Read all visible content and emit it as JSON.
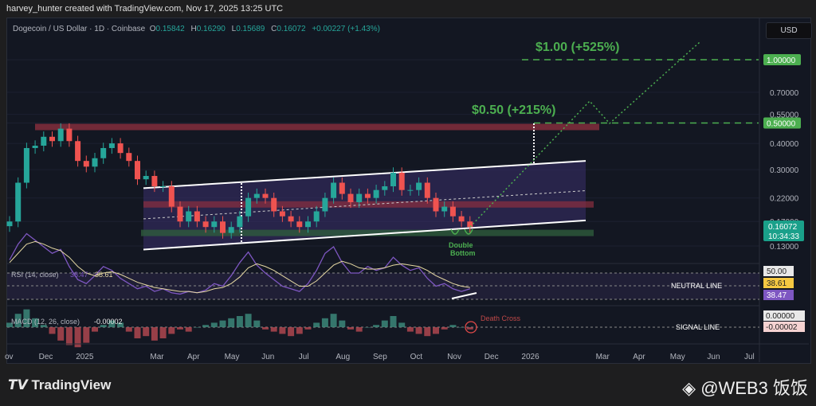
{
  "header": {
    "credit": "harvey_hunter created with TradingView.com, Nov 17, 2025 13:25 UTC"
  },
  "legend": {
    "symbol": "Dogecoin / US Dollar · 1D · Coinbase",
    "o_label": "O",
    "o": "0.15842",
    "h_label": "H",
    "h": "0.16290",
    "l_label": "L",
    "l": "0.15689",
    "c_label": "C",
    "c": "0.16072",
    "change": "+0.00227 (+1.43%)"
  },
  "currency": "USD",
  "colors": {
    "up": "#26a69a",
    "down": "#ef5350",
    "target": "#4caf50",
    "rsi": "#7e57c2",
    "rsi_ma": "#e6d9a3",
    "zone_red": "#8b2f3f",
    "channel": "#3b2f6b"
  },
  "chart_data": {
    "type": "candlestick",
    "title": "Dogecoin / US Dollar · 1D · Coinbase",
    "y_scale": "log",
    "ylim": [
      0.115,
      1.3
    ],
    "y_ticks": [
      "1.00000",
      "0.70000",
      "0.55000",
      "0.50000",
      "0.40000",
      "0.30000",
      "0.22000",
      "0.17000",
      "0.13000"
    ],
    "x_ticks": [
      "ov",
      "Dec",
      "2025",
      "Mar",
      "Apr",
      "May",
      "Jun",
      "Jul",
      "Aug",
      "Sep",
      "Oct",
      "Nov",
      "Dec",
      "2026",
      "Mar",
      "Apr",
      "May",
      "Jun",
      "Jul"
    ],
    "x_tick_months": [
      0,
      1,
      2,
      4,
      5,
      6,
      7,
      8,
      9,
      10,
      11,
      12,
      13,
      14,
      16,
      17,
      18,
      19,
      20
    ],
    "weekly_closes": [
      0.17,
      0.26,
      0.38,
      0.39,
      0.43,
      0.41,
      0.47,
      0.41,
      0.33,
      0.31,
      0.34,
      0.38,
      0.4,
      0.36,
      0.33,
      0.27,
      0.28,
      0.25,
      0.25,
      0.2,
      0.17,
      0.19,
      0.17,
      0.16,
      0.17,
      0.15,
      0.16,
      0.18,
      0.22,
      0.23,
      0.22,
      0.19,
      0.18,
      0.17,
      0.16,
      0.17,
      0.19,
      0.22,
      0.26,
      0.23,
      0.21,
      0.23,
      0.22,
      0.24,
      0.25,
      0.29,
      0.24,
      0.24,
      0.26,
      0.22,
      0.19,
      0.2,
      0.18,
      0.17,
      0.16
    ],
    "rsi": [
      60,
      72,
      80,
      75,
      70,
      65,
      68,
      55,
      45,
      42,
      48,
      55,
      52,
      46,
      42,
      38,
      40,
      36,
      38,
      35,
      34,
      36,
      35,
      37,
      42,
      40,
      48,
      58,
      66,
      56,
      50,
      45,
      40,
      38,
      36,
      42,
      52,
      65,
      70,
      58,
      50,
      50,
      55,
      52,
      54,
      62,
      56,
      52,
      54,
      46,
      40,
      42,
      38,
      36,
      38
    ],
    "rsi_ma": [
      58,
      65,
      72,
      74,
      72,
      69,
      67,
      62,
      55,
      50,
      48,
      50,
      51,
      49,
      46,
      43,
      41,
      39,
      38,
      37,
      36,
      36,
      35,
      36,
      38,
      39,
      42,
      47,
      54,
      57,
      55,
      52,
      48,
      44,
      40,
      40,
      44,
      50,
      56,
      59,
      57,
      54,
      53,
      53,
      54,
      56,
      57,
      56,
      55,
      52,
      48,
      45,
      42,
      40,
      39
    ],
    "macd_hist": [
      0.002,
      0.006,
      0.008,
      0.004,
      0.001,
      -0.003,
      -0.006,
      -0.008,
      -0.009,
      -0.007,
      -0.002,
      0.001,
      0.003,
      0.002,
      -0.002,
      -0.005,
      -0.004,
      -0.006,
      -0.005,
      -0.003,
      -0.001,
      -0.002,
      0.0,
      0.001,
      0.002,
      0.003,
      0.004,
      0.005,
      0.006,
      0.003,
      -0.001,
      -0.002,
      -0.003,
      -0.004,
      -0.003,
      -0.001,
      0.002,
      0.004,
      0.006,
      0.003,
      -0.001,
      -0.002,
      0.0,
      0.001,
      0.003,
      0.005,
      0.002,
      -0.002,
      -0.003,
      -0.004,
      -0.003,
      -0.001,
      0.001,
      0.0,
      -0.001
    ],
    "annotations": {
      "target1": "$0.50 (+215%)",
      "target2": "$1.00 (+525%)",
      "pattern": "Double Bottom",
      "pattern2": "Bottom",
      "death_cross": "Death Cross",
      "neutral_line": "NEUTRAL LINE",
      "signal_line": "SIGNAL LINE",
      "target_levels": [
        0.5,
        1.0
      ],
      "resistance_zone": 0.48,
      "mid_zone": 0.205,
      "support_zone": 0.15
    },
    "price_labels": {
      "t1": "1.00000",
      "t2": "0.50000",
      "last": "0.16072",
      "countdown": "10:34:33"
    },
    "rsi_pane": {
      "label": "RSI (14, close)",
      "v1": "38.47",
      "v2": "38.61",
      "levels": [
        "50.00",
        "38.61",
        "38.47"
      ]
    },
    "macd_pane": {
      "label": "MACD (12, 26, close)",
      "v": "-0.00002",
      "levels": [
        "0.00000",
        "-0.00002"
      ]
    }
  },
  "footer": {
    "brand": "TradingView",
    "watermark": "@WEB3 饭饭"
  }
}
